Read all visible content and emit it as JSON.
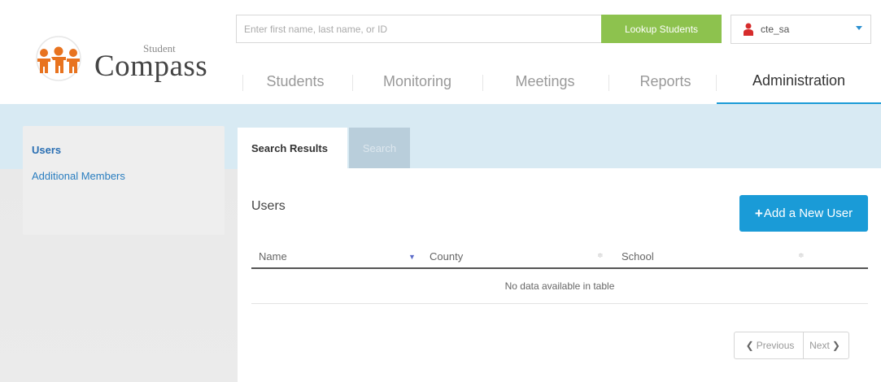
{
  "brand": {
    "small": "Student",
    "name": "Compass"
  },
  "search": {
    "placeholder": "Enter first name, last name, or ID",
    "button": "Lookup Students"
  },
  "user": {
    "name": "cte_sa"
  },
  "nav": {
    "items": [
      {
        "label": "Students"
      },
      {
        "label": "Monitoring"
      },
      {
        "label": "Meetings"
      },
      {
        "label": "Reports"
      },
      {
        "label": "Administration"
      }
    ],
    "active": "Administration"
  },
  "sidebar": {
    "items": [
      {
        "label": "Users"
      },
      {
        "label": "Additional Members"
      }
    ]
  },
  "tabs": {
    "results": "Search Results",
    "search": "Search"
  },
  "panel": {
    "title": "Users",
    "add_button": "Add a New User",
    "columns": [
      "Name",
      "County",
      "School"
    ],
    "empty_message": "No data available in table",
    "pager": {
      "previous": "Previous",
      "next": "Next"
    }
  },
  "colors": {
    "accent": "#1a9bd7",
    "lookup": "#8dc24e",
    "tab_inactive": "#b9cedb"
  }
}
